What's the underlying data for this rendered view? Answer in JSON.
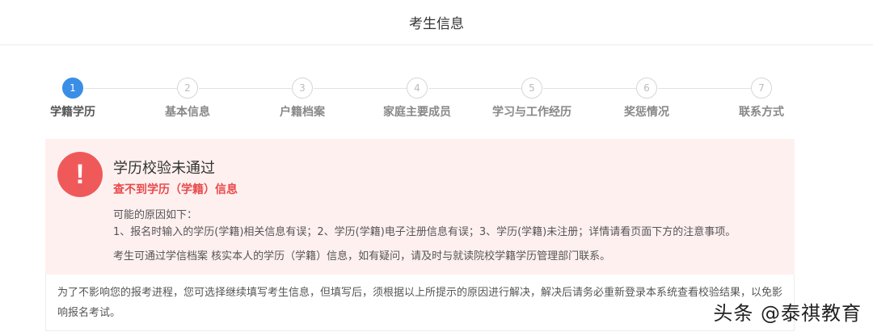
{
  "header": {
    "title": "考生信息"
  },
  "steps": [
    {
      "num": "1",
      "label": "学籍学历",
      "active": true
    },
    {
      "num": "2",
      "label": "基本信息",
      "active": false
    },
    {
      "num": "3",
      "label": "户籍档案",
      "active": false
    },
    {
      "num": "4",
      "label": "家庭主要成员",
      "active": false
    },
    {
      "num": "5",
      "label": "学习与工作经历",
      "active": false
    },
    {
      "num": "6",
      "label": "奖惩情况",
      "active": false
    },
    {
      "num": "7",
      "label": "联系方式",
      "active": false
    }
  ],
  "alert": {
    "icon": "exclamation-icon",
    "icon_glyph": "!",
    "title": "学历校验未通过",
    "subtitle": "查不到学历（学籍）信息",
    "reason_heading": "可能的原因如下：",
    "reasons": "1、报名时输入的学历(学籍)相关信息有误；2、学历(学籍)电子注册信息有误；3、学历(学籍)未注册；详情请看页面下方的注意事项。",
    "advice": "考生可通过学信档案 核实本人的学历（学籍）信息，如有疑问，请及时与就读院校学籍学历管理部门联系。"
  },
  "notice": {
    "text": "为了不影响您的报考进程，您可选择继续填写考生信息，但填写后，须根据以上所提示的原因进行解决，解决后请务必重新登录本系统查看校验结果，以免影响报名考试。"
  },
  "watermark": "头条 @泰祺教育",
  "colors": {
    "accent": "#3a8ee6",
    "error": "#f0595a",
    "alert_bg": "#fff0f0"
  }
}
